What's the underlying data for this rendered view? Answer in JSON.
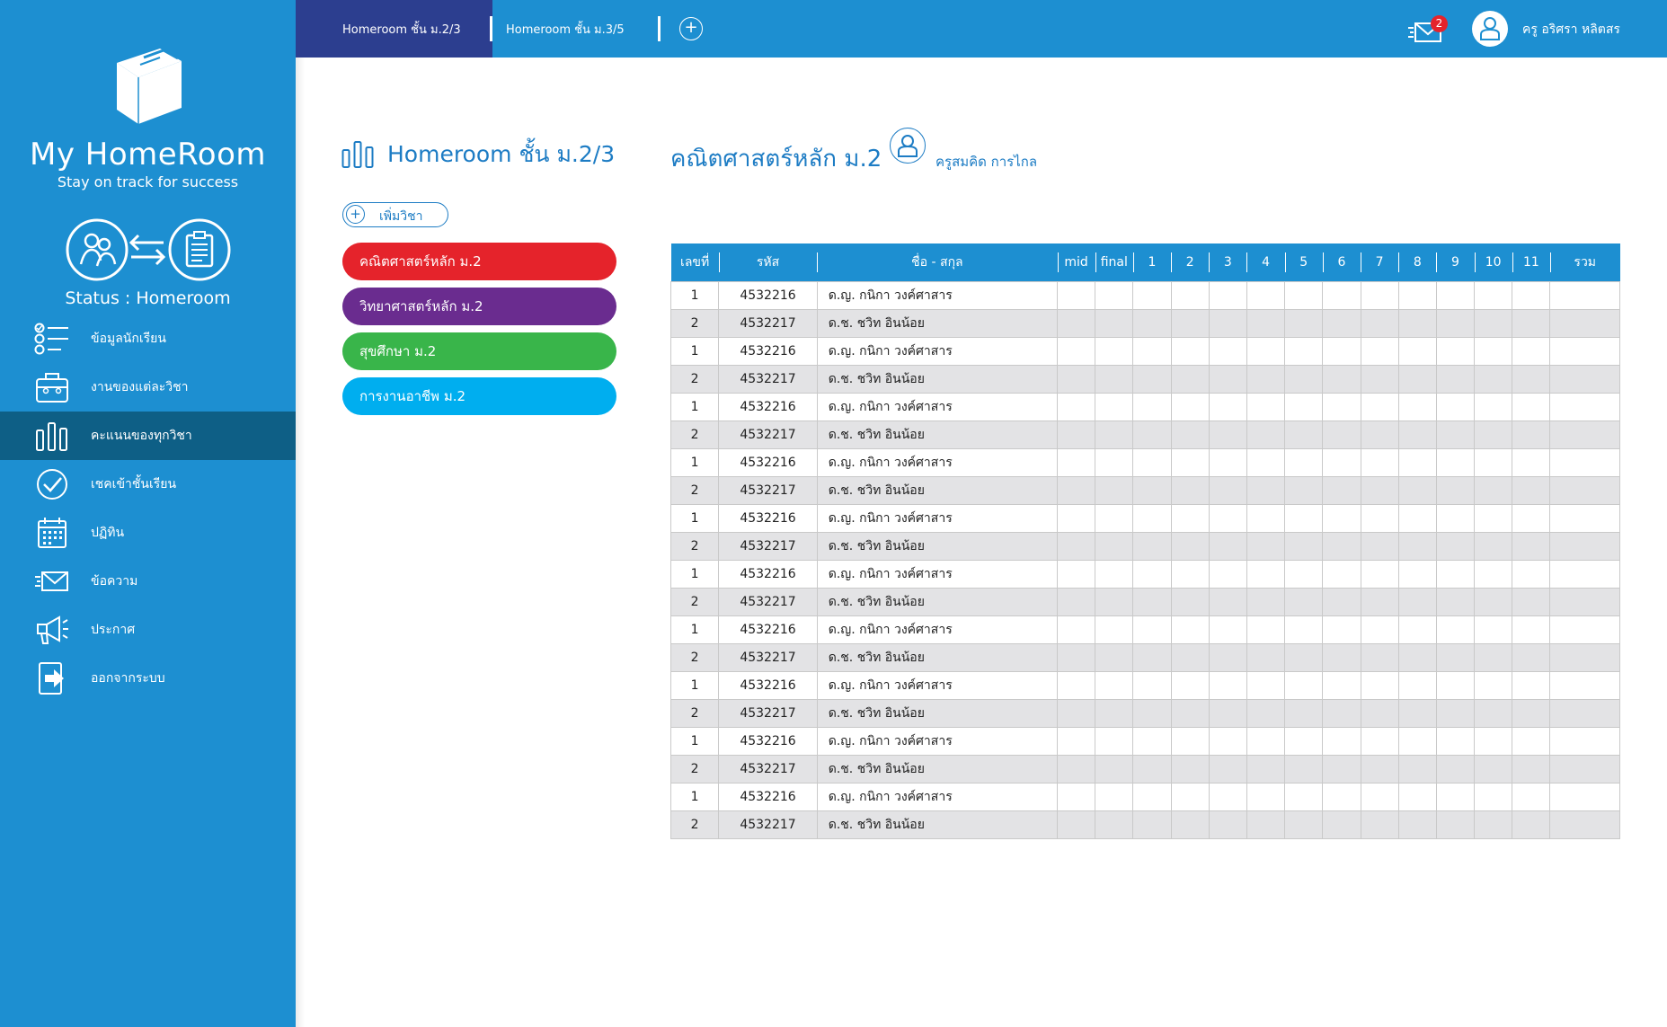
{
  "brand": {
    "title": "My HomeRoom",
    "subtitle": "Stay on track for success",
    "status": "Status : Homeroom"
  },
  "sidebar": {
    "items": [
      {
        "label": "ข้อมูลนักเรียน",
        "icon": "student-list-icon"
      },
      {
        "label": "งานของแต่ละวิชา",
        "icon": "briefcase-icon"
      },
      {
        "label": "คะแนนของทุกวิชา",
        "icon": "bar-chart-icon"
      },
      {
        "label": "เชคเข้าชั้นเรียน",
        "icon": "check-circle-icon"
      },
      {
        "label": "ปฏิทิน",
        "icon": "calendar-icon"
      },
      {
        "label": "ข้อความ",
        "icon": "mail-icon"
      },
      {
        "label": "ประกาศ",
        "icon": "megaphone-icon"
      },
      {
        "label": "ออกจากระบบ",
        "icon": "logout-icon"
      }
    ]
  },
  "topbar": {
    "tabs": [
      "Homeroom ชั้น ม.2/3",
      "Homeroom ชั้น ม.3/5"
    ],
    "add_tab": "+",
    "badge_count": "2",
    "user_name": "ครู อริศรา หลิตสร"
  },
  "content": {
    "page_title": "Homeroom ชั้น ม.2/3",
    "add_subject_label": "เพิ่มวิชา",
    "subjects": [
      {
        "label": "คณิตศาสตร์หลัก ม.2",
        "color": "#e5232b"
      },
      {
        "label": "วิทยาศาสตร์หลัก ม.2",
        "color": "#6a2c8f"
      },
      {
        "label": "สุขศึกษา ม.2",
        "color": "#39b54a"
      },
      {
        "label": "การงานอาชีพ ม.2",
        "color": "#00aeef"
      }
    ],
    "course_title": "คณิตศาสตร์หลัก ม.2",
    "teacher_name": "ครูสมคิด การไกล"
  },
  "table": {
    "headers": [
      "เลขที่",
      "รหัส",
      "ชื่อ - สกุล",
      "mid",
      "final",
      "1",
      "2",
      "3",
      "4",
      "5",
      "6",
      "7",
      "8",
      "9",
      "10",
      "11",
      "รวม"
    ],
    "rows": [
      [
        "1",
        "4532216",
        "ด.ญ. กนิกา วงค์ศาสาร"
      ],
      [
        "2",
        "4532217",
        "ด.ช. ชวิท อินน้อย"
      ],
      [
        "1",
        "4532216",
        "ด.ญ. กนิกา วงค์ศาสาร"
      ],
      [
        "2",
        "4532217",
        "ด.ช. ชวิท อินน้อย"
      ],
      [
        "1",
        "4532216",
        "ด.ญ. กนิกา วงค์ศาสาร"
      ],
      [
        "2",
        "4532217",
        "ด.ช. ชวิท อินน้อย"
      ],
      [
        "1",
        "4532216",
        "ด.ญ. กนิกา วงค์ศาสาร"
      ],
      [
        "2",
        "4532217",
        "ด.ช. ชวิท อินน้อย"
      ],
      [
        "1",
        "4532216",
        "ด.ญ. กนิกา วงค์ศาสาร"
      ],
      [
        "2",
        "4532217",
        "ด.ช. ชวิท อินน้อย"
      ],
      [
        "1",
        "4532216",
        "ด.ญ. กนิกา วงค์ศาสาร"
      ],
      [
        "2",
        "4532217",
        "ด.ช. ชวิท อินน้อย"
      ],
      [
        "1",
        "4532216",
        "ด.ญ. กนิกา วงค์ศาสาร"
      ],
      [
        "2",
        "4532217",
        "ด.ช. ชวิท อินน้อย"
      ],
      [
        "1",
        "4532216",
        "ด.ญ. กนิกา วงค์ศาสาร"
      ],
      [
        "2",
        "4532217",
        "ด.ช. ชวิท อินน้อย"
      ],
      [
        "1",
        "4532216",
        "ด.ญ. กนิกา วงค์ศาสาร"
      ],
      [
        "2",
        "4532217",
        "ด.ช. ชวิท อินน้อย"
      ],
      [
        "1",
        "4532216",
        "ด.ญ. กนิกา วงค์ศาสาร"
      ],
      [
        "2",
        "4532217",
        "ด.ช. ชวิท อินน้อย"
      ]
    ]
  },
  "colors": {
    "sidebar_bg": "#1d8fd1",
    "sidebar_active": "#0e5f86",
    "active_tab": "#2c3e8f",
    "accent_text": "#1d7cc4",
    "badge": "#e5232b"
  }
}
